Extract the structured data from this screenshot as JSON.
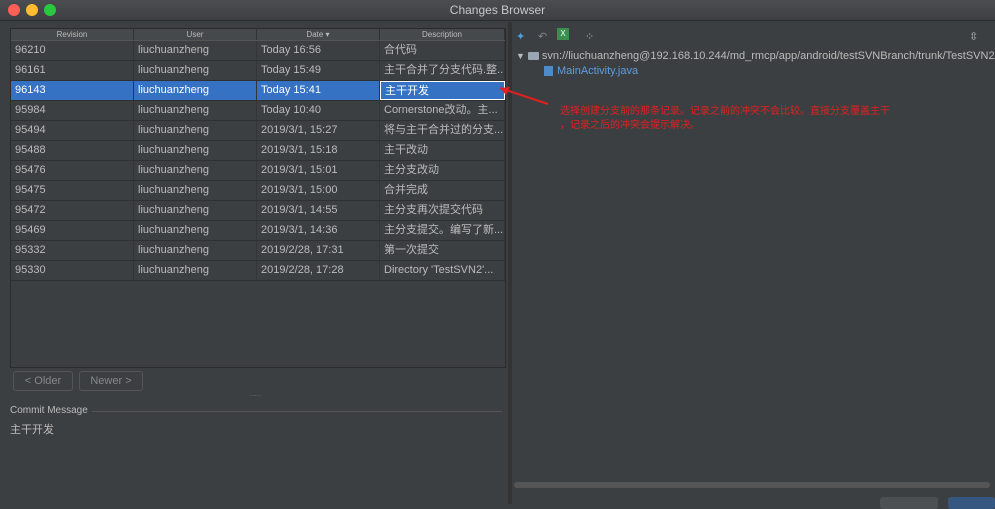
{
  "window": {
    "title": "Changes Browser"
  },
  "table": {
    "headers": [
      "Revision",
      "User",
      "Date ▾",
      "Description"
    ],
    "rows": [
      [
        "96210",
        "liuchuanzheng",
        "Today 16:56",
        "合代码"
      ],
      [
        "96161",
        "liuchuanzheng",
        "Today 15:49",
        "主干合并了分支代码.整..."
      ],
      [
        "96143",
        "liuchuanzheng",
        "Today 15:41",
        "主干开发"
      ],
      [
        "95984",
        "liuchuanzheng",
        "Today 10:40",
        "Cornerstone改动。主..."
      ],
      [
        "95494",
        "liuchuanzheng",
        "2019/3/1, 15:27",
        "将与主干合并过的分支..."
      ],
      [
        "95488",
        "liuchuanzheng",
        "2019/3/1, 15:18",
        "主干改动"
      ],
      [
        "95476",
        "liuchuanzheng",
        "2019/3/1, 15:01",
        "主分支改动"
      ],
      [
        "95475",
        "liuchuanzheng",
        "2019/3/1, 15:00",
        "合并完成"
      ],
      [
        "95472",
        "liuchuanzheng",
        "2019/3/1, 14:55",
        "主分支再次提交代码"
      ],
      [
        "95469",
        "liuchuanzheng",
        "2019/3/1, 14:36",
        "主分支提交。编写了新..."
      ],
      [
        "95332",
        "liuchuanzheng",
        "2019/2/28, 17:31",
        "第一次提交"
      ],
      [
        "95330",
        "liuchuanzheng",
        "2019/2/28, 17:28",
        " Directory 'TestSVN2'..."
      ]
    ],
    "selected_index": 2
  },
  "paging": {
    "older_label": "< Older",
    "newer_label": "Newer >"
  },
  "commit": {
    "label": "Commit Message",
    "text": "主干开发"
  },
  "right_panel": {
    "toolbar_icons": [
      "diff-icon",
      "revert-icon",
      "excel-icon",
      "group-icon",
      "expand-icon"
    ],
    "tree_path": "svn://liuchuanzheng@192.168.10.244/md_rmcp/app/android/testSVNBranch/trunk/TestSVN2/",
    "tree_file": "MainActivity.java"
  },
  "annotation": {
    "line1": "选择创建分支前的那条记录。记录之前的冲突不会比较。直接分支覆盖主干",
    "line2": "，记录之后的冲突会提示解决。",
    "color": "#e02020"
  },
  "colors": {
    "selection": "#3572c3",
    "bg": "#3c3f41",
    "link": "#5e9ede"
  }
}
